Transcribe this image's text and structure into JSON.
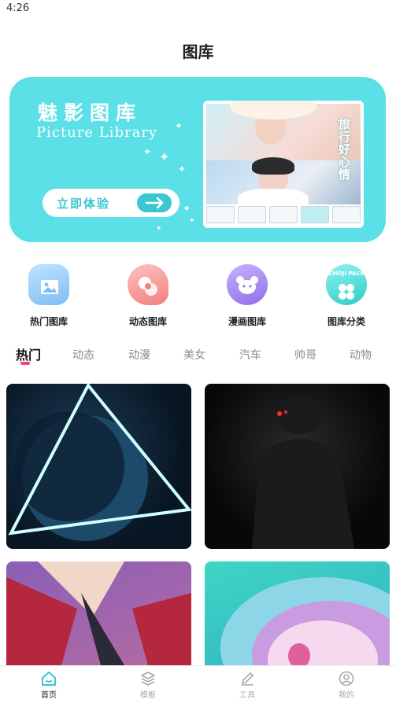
{
  "status": {
    "time": "4:26"
  },
  "header": {
    "title": "图库"
  },
  "banner": {
    "title": "魅影图库",
    "subtitle": "Picture Library",
    "cta": "立即体验",
    "photo_caption": "旅行好心情"
  },
  "categories": [
    {
      "label": "热门图库",
      "icon": "image-icon",
      "color": "#8bc8f5"
    },
    {
      "label": "动态图库",
      "icon": "swirl-icon",
      "color": "#f58a8a"
    },
    {
      "label": "漫画图库",
      "icon": "bear-icon",
      "color": "#a98cf0"
    },
    {
      "label": "图库分类",
      "icon": "emoji-pack-icon",
      "color": "#43d7d3",
      "badge": "EMOJI PACK"
    }
  ],
  "tabs": [
    "热门",
    "动态",
    "动漫",
    "美女",
    "汽车",
    "帅哥",
    "动物"
  ],
  "active_tab": "热门",
  "nav": [
    {
      "label": "首页",
      "icon": "home-icon"
    },
    {
      "label": "模板",
      "icon": "layers-icon"
    },
    {
      "label": "工具",
      "icon": "pencil-icon"
    },
    {
      "label": "我的",
      "icon": "user-icon"
    }
  ],
  "colors": {
    "accent": "#5ae0e6",
    "tab_indicator": "#ff3d7a",
    "nav_active": "#3ac7d0"
  }
}
